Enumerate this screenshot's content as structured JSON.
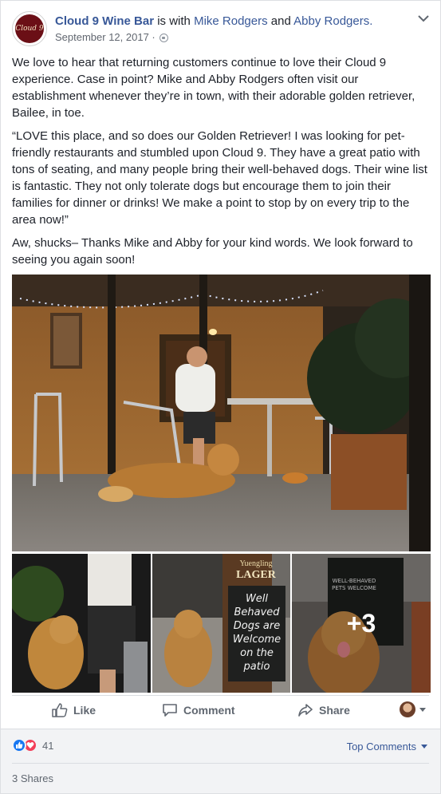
{
  "post": {
    "page_name": "Cloud 9 Wine Bar",
    "is_with": "is with",
    "tag_1": "Mike Rodgers",
    "and": "and",
    "tag_2": "Abby Rodgers.",
    "date": "September 12, 2017 ·",
    "logo_text": "Cloud 9",
    "paragraphs": [
      "We love to hear that returning customers continue to love their Cloud 9 experience. Case in point? Mike and Abby Rodgers often visit our establishment whenever they’re in town, with their adorable golden retriever, Bailee, in toe.",
      "“LOVE this place, and so does our Golden Retriever! I was looking for pet-friendly restaurants and stumbled upon Cloud 9. They have a great patio with tons of seating, and many people bring their well-behaved dogs. Their wine list is fantastic. They not only tolerate dogs but encourage them to join their families for dinner or drinks! We make a point to stop by on every trip to the area now!”",
      "Aw, shucks– Thanks Mike and Abby for your kind words. We look forward to seeing you again soon!"
    ],
    "more_photos": "+3",
    "sign_lager_top": "Yuengling",
    "sign_lager": "LAGER",
    "sign_chalk": "Well Behaved Dogs are Welcome on the patio",
    "sign_pets": "WELL-BEHAVED PETS WELCOME"
  },
  "actions": {
    "like": "Like",
    "comment": "Comment",
    "share": "Share"
  },
  "footer": {
    "reaction_count": "41",
    "top_comments": "Top Comments",
    "shares": "3 Shares"
  },
  "colors": {
    "link": "#385898",
    "like_blue": "#1877f2",
    "love_red": "#f33e58"
  },
  "icons": [
    "globe-icon",
    "chevron-down-icon",
    "thumbs-up-icon",
    "comment-icon",
    "share-icon",
    "like-reaction-icon",
    "love-reaction-icon"
  ]
}
